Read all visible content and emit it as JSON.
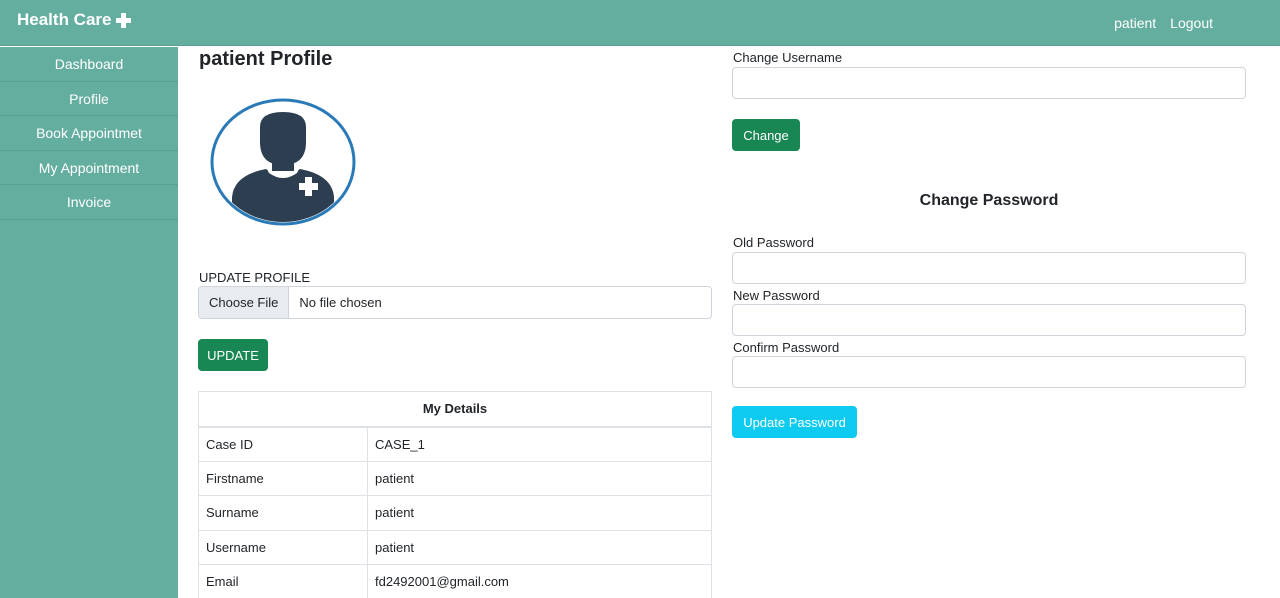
{
  "navbar": {
    "brand": "Health Care",
    "brand_icon": "plus-icon",
    "user_link": "patient",
    "logout_link": "Logout"
  },
  "sidebar": {
    "items": [
      {
        "label": "Dashboard"
      },
      {
        "label": "Profile"
      },
      {
        "label": "Book Appointmet"
      },
      {
        "label": "My Appointment"
      },
      {
        "label": "Invoice"
      }
    ]
  },
  "profile": {
    "title": "patient Profile",
    "avatar_icon": "patient-avatar-icon",
    "update_label": "UPDATE PROFILE",
    "file_button": "Choose File",
    "file_status": "No file chosen",
    "update_button": "UPDATE"
  },
  "details": {
    "header": "My Details",
    "rows": [
      {
        "key": "Case ID",
        "value": "CASE_1"
      },
      {
        "key": "Firstname",
        "value": "patient"
      },
      {
        "key": "Surname",
        "value": "patient"
      },
      {
        "key": "Username",
        "value": "patient"
      },
      {
        "key": "Email",
        "value": "fd2492001@gmail.com"
      }
    ]
  },
  "username_form": {
    "label": "Change Username",
    "value": "",
    "button": "Change"
  },
  "password_form": {
    "title": "Change Password",
    "old_label": "Old Password",
    "new_label": "New Password",
    "confirm_label": "Confirm Password",
    "button": "Update Password"
  },
  "colors": {
    "nav_bg": "#64ae9f",
    "success": "#198754",
    "info": "#0dcaf0",
    "avatar_ring": "#2a7ab8",
    "avatar_fill": "#2c3e50"
  }
}
